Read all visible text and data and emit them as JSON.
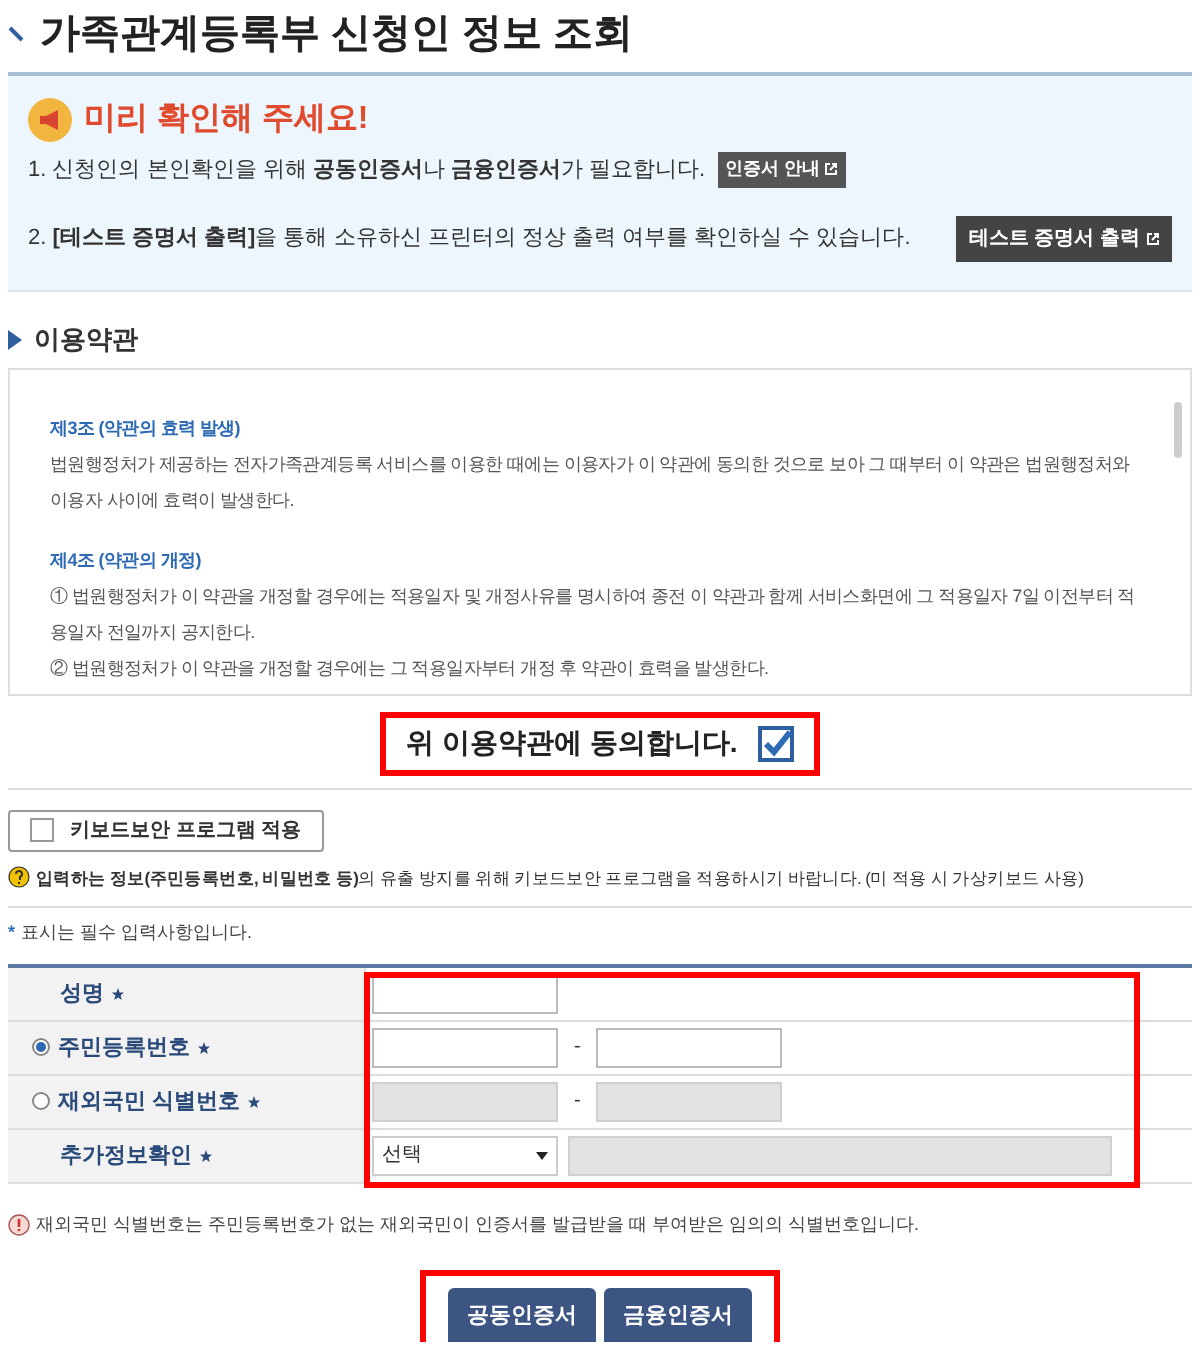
{
  "page_title": "가족관계등록부 신청인 정보 조회",
  "notice": {
    "title": "미리 확인해 주세요!",
    "items": [
      {
        "text": "1. 신청인의 본인확인을 위해 **공동인증서**나 **금융인증서**가 필요합니다.",
        "button": "인증서 안내"
      },
      {
        "text": "2. **[테스트 증명서 출력]**을 통해 소유하신 프린터의 정상 출력 여부를 확인하실 수 있습니다.",
        "button": "테스트 증명서 출력"
      }
    ]
  },
  "terms": {
    "title": "이용약관",
    "articles": [
      {
        "heading": "제3조 (약관의 효력 발생)",
        "lines": [
          "법원행정처가 제공하는 전자가족관계등록 서비스를 이용한 때에는 이용자가 이 약관에 동의한 것으로 보아 그 때부터 이 약관은 법원행정처와 이용자 사이에 효력이 발생한다."
        ]
      },
      {
        "heading": "제4조 (약관의 개정)",
        "lines": [
          "① 법원행정처가 이 약관을 개정할 경우에는 적용일자 및 개정사유를 명시하여 종전 이 약관과 함께 서비스화면에 그 적용일자 7일 이전부터 적용일자 전일까지 공지한다.",
          "② 법원행정처가 이 약관을 개정할 경우에는 그 적용일자부터 개정 후 약관이 효력을 발생한다."
        ]
      }
    ]
  },
  "agree": {
    "label": "위 이용약관에 동의합니다.",
    "checked": true,
    "highlighted": true
  },
  "keyboard_security": {
    "label": "키보드보안 프로그램 적용",
    "checked": false
  },
  "help_text": "**입력하는 정보(주민등록번호, 비밀번호 등)**의 유출 방지를 위해 키보드보안 프로그램을 적용하시기 바랍니다. (미 적용 시 가상키보드 사용)",
  "required_note": {
    "mark": "*",
    "text": "표시는 필수 입력사항입니다."
  },
  "form": {
    "highlighted": true,
    "rows": [
      {
        "kind": "single",
        "label": "성명",
        "required": true,
        "disabled": false
      },
      {
        "kind": "pair",
        "label": "주민등록번호",
        "required": true,
        "selected": true,
        "separator": "-",
        "disabled": false
      },
      {
        "kind": "pair",
        "label": "재외국민 식별번호",
        "required": true,
        "selected": false,
        "separator": "-",
        "disabled": true
      },
      {
        "kind": "select",
        "label": "추가정보확인",
        "required": true,
        "value": "선택",
        "disabled": true
      }
    ]
  },
  "warning": "재외국민 식별번호는 주민등록번호가 없는 재외국민이 인증서를 발급받을 때 부여받은 임의의 식별번호입니다.",
  "actions": {
    "highlighted": true,
    "buttons": [
      "공동인증서",
      "금융인증서"
    ]
  }
}
